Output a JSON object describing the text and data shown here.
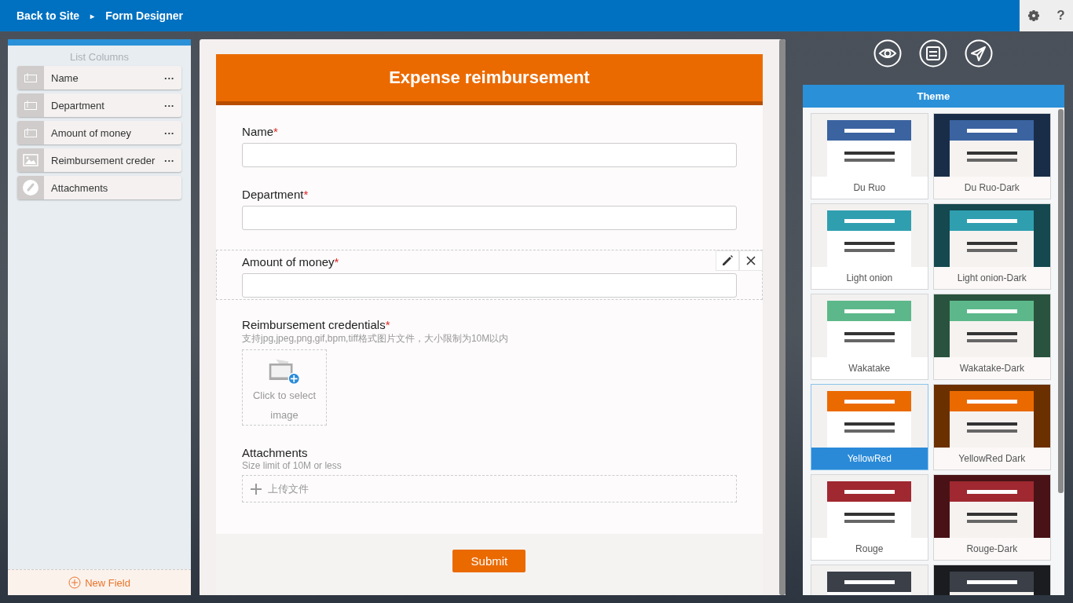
{
  "topbar": {
    "breadcrumb": [
      {
        "label": "Back to Site"
      },
      {
        "label": "Form Designer"
      }
    ],
    "separator": "▸",
    "help": "?"
  },
  "list_columns": {
    "title": "List Columns",
    "items": [
      {
        "label": "Name",
        "kind": "text",
        "menu": "···"
      },
      {
        "label": "Department",
        "kind": "text",
        "menu": "···"
      },
      {
        "label": "Amount of money",
        "kind": "text",
        "menu": "···"
      },
      {
        "label": "Reimbursement creder",
        "kind": "image",
        "menu": "···"
      },
      {
        "label": "Attachments",
        "kind": "file"
      }
    ],
    "new_field": "New Field"
  },
  "form": {
    "title": "Expense reimbursement",
    "fields": [
      {
        "kind": "text",
        "label": "Name",
        "required": "*",
        "selected": false
      },
      {
        "kind": "text",
        "label": "Department",
        "required": "*",
        "selected": false
      },
      {
        "kind": "text",
        "label": "Amount of money",
        "required": "*",
        "selected": true
      },
      {
        "kind": "image",
        "label": "Reimbursement credentials",
        "required": "*",
        "hint": "支持jpg,jpeg,png,gif,bpm,tiff格式图片文件，大小限制为10M以内",
        "upload_text": "Click to select image",
        "selected": false
      },
      {
        "kind": "file",
        "label": "Attachments",
        "hint": "Size limit of 10M or less",
        "upload_text": "上传文件",
        "selected": false
      }
    ],
    "submit": "Submit"
  },
  "theme": {
    "title": "Theme",
    "items": [
      {
        "name": "Du Ruo",
        "kind": "light",
        "color": "#3a63a0",
        "selected": false
      },
      {
        "name": "Du Ruo-Dark",
        "kind": "dark",
        "color": "#3a63a0",
        "selected": false
      },
      {
        "name": "Light onion",
        "kind": "light",
        "color": "#2f9fb0",
        "selected": false
      },
      {
        "name": "Light onion-Dark",
        "kind": "dark",
        "color": "#2f9fb0",
        "selected": false
      },
      {
        "name": "Wakatake",
        "kind": "light",
        "color": "#5cb88a",
        "selected": false
      },
      {
        "name": "Wakatake-Dark",
        "kind": "dark",
        "color": "#5cb88a",
        "selected": false
      },
      {
        "name": "YellowRed",
        "kind": "light",
        "color": "#eb6a00",
        "selected": true
      },
      {
        "name": "YellowRed Dark",
        "kind": "dark",
        "color": "#eb6a00",
        "selected": false
      },
      {
        "name": "Rouge",
        "kind": "light",
        "color": "#a02830",
        "selected": false
      },
      {
        "name": "Rouge-Dark",
        "kind": "dark",
        "color": "#a02830",
        "selected": false
      },
      {
        "kind": "light",
        "color": "#3a3f48",
        "selected": false
      },
      {
        "kind": "dark",
        "color": "#3a3f48",
        "selected": false
      }
    ]
  }
}
